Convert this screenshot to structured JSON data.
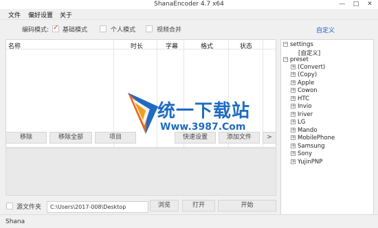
{
  "window": {
    "title": "ShanaEncoder 4.7 x64",
    "minimize": "—",
    "maximize": "□",
    "close": "✕"
  },
  "menu": {
    "file": "文件",
    "preferences": "偏好设置",
    "about": "关于"
  },
  "options": {
    "encode_mode_label": "编码模式:",
    "basic_mode": "基础模式",
    "basic_checked": true,
    "personal_mode": "个人模式",
    "personal_checked": false,
    "video_merge": "视频合并",
    "video_merge_checked": false,
    "custom_link": "自定义"
  },
  "table": {
    "columns": [
      "名称",
      "时长",
      "字幕",
      "格式",
      "状态"
    ]
  },
  "watermark": {
    "text": "统一下载站",
    "url": "Www.3987.Com"
  },
  "buttons": {
    "remove": "移除",
    "remove_all": "移除全部",
    "project": "项目",
    "quick_settings": "快速设置",
    "add_file": "添加文件",
    "more": ">",
    "browse": "浏览",
    "open": "打开",
    "start": "开始"
  },
  "tree": {
    "settings": "settings",
    "custom": "[自定义]",
    "preset": "preset",
    "presets": [
      "(Convert)",
      "(Copy)",
      "Apple",
      "Cowon",
      "HTC",
      "Invio",
      "Iriver",
      "LG",
      "Mando",
      "MobilePhone",
      "Samsung",
      "Sony",
      "YujinPNP"
    ]
  },
  "output": {
    "source_folder_label": "源文件夹",
    "source_folder_checked": false,
    "path": "C:\\Users\\2017-008\\Desktop"
  },
  "status": {
    "text": "Shana"
  },
  "colors": {
    "accent": "#1a5fd1",
    "watermark": "#1f6bc2",
    "check": "#d04040"
  }
}
